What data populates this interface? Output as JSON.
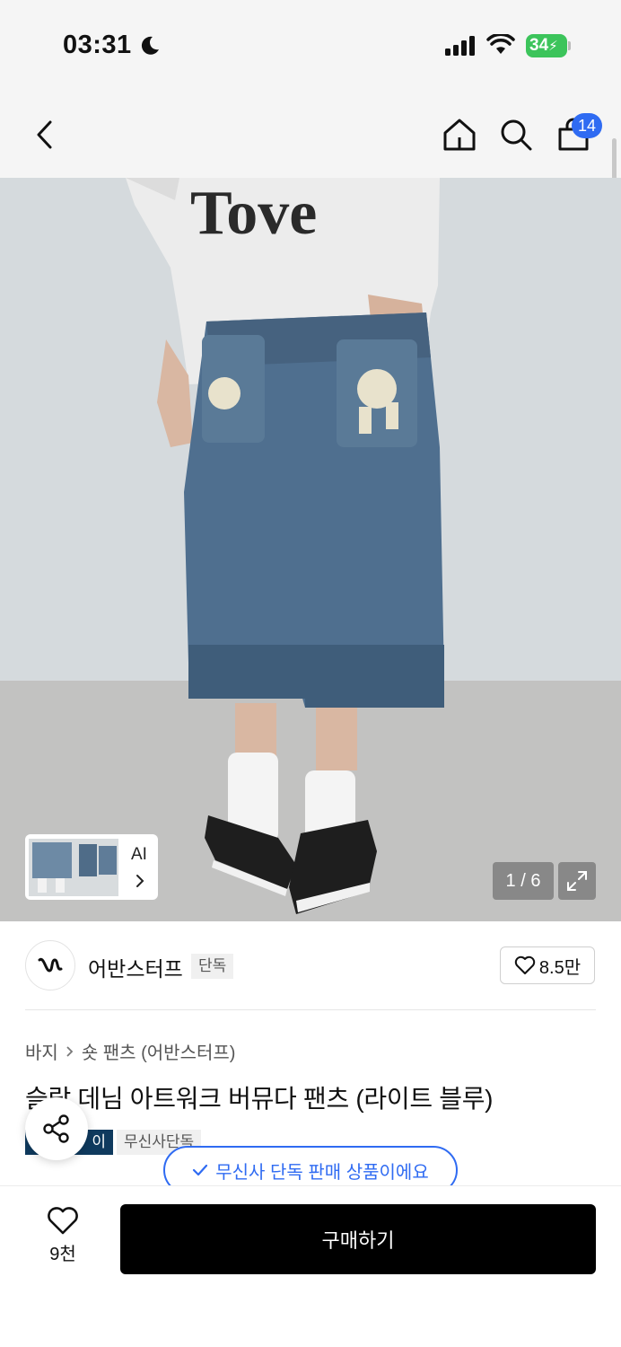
{
  "status_bar": {
    "time": "03:31",
    "battery": "34"
  },
  "nav": {
    "cart_count": "14"
  },
  "hero": {
    "shirt_print": "Tove",
    "thumb_label": "AI",
    "page_indicator": "1 / 6"
  },
  "brand": {
    "name": "어반스터프",
    "tag": "단독",
    "likes": "8.5만"
  },
  "breadcrumb": {
    "category": "바지",
    "subcategory": "숏 팬츠 (어반스터프)"
  },
  "product": {
    "title": "슬랍 데님 아트워크 버뮤다 팬츠 (라이트 블루)",
    "badge_dark": "이",
    "badge_gray": "무신사단독",
    "exclusive_notice": "무신사 단독 판매 상품이에요"
  },
  "bottom": {
    "wish_count": "9천",
    "buy_label": "구매하기"
  },
  "colors": {
    "accent": "#2f6bf2",
    "buy_button": "#000000",
    "badge_dark": "#0f3a5e"
  }
}
